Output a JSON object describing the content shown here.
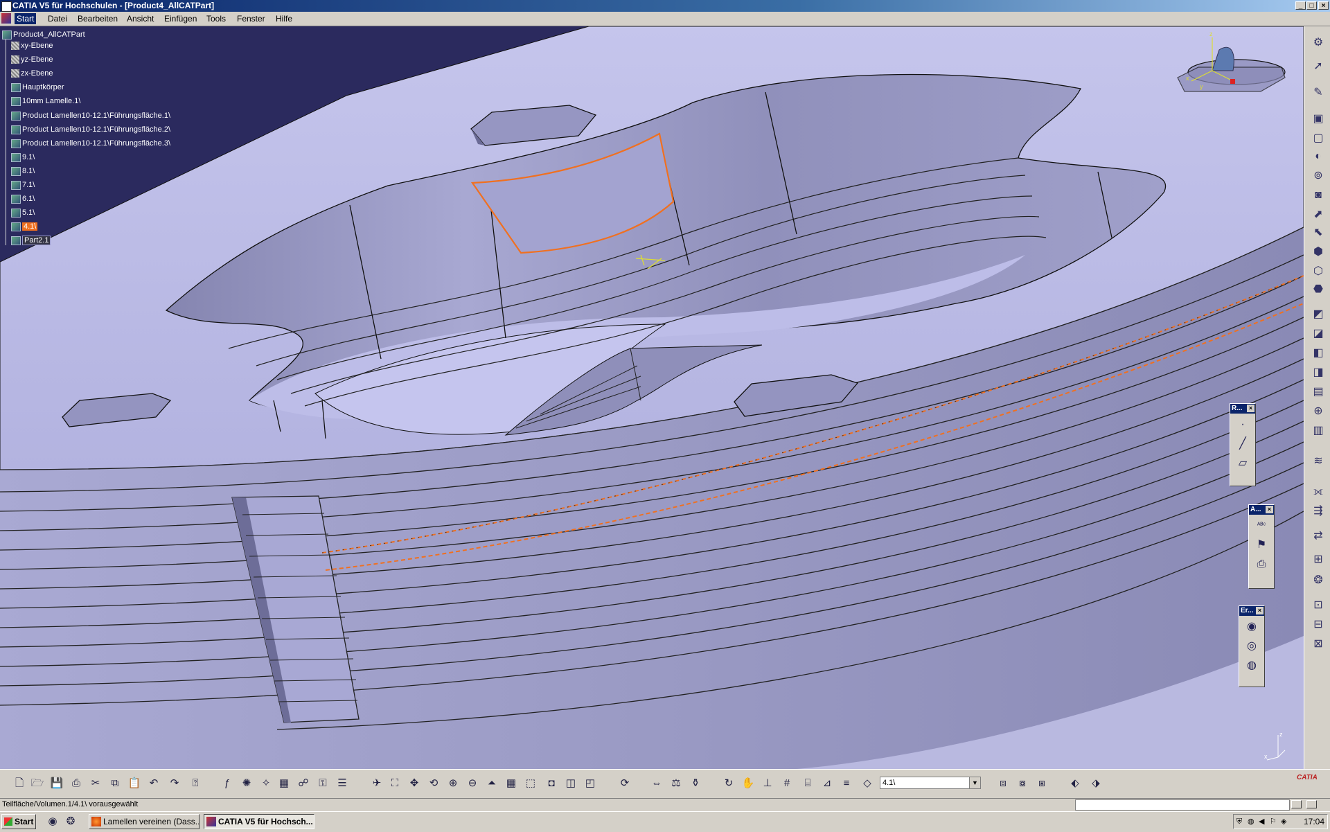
{
  "window": {
    "title": "CATIA V5 für Hochschulen - [Product4_AllCATPart]",
    "controls": {
      "minimize": "_",
      "maximize": "□",
      "close": "×"
    }
  },
  "menu": [
    "Start",
    "Datei",
    "Bearbeiten",
    "Ansicht",
    "Einfügen",
    "Tools",
    "Fenster",
    "Hilfe"
  ],
  "tree": {
    "root": "Product4_AllCATPart",
    "items": [
      {
        "label": "xy-Ebene",
        "icon": "plane-icon"
      },
      {
        "label": "yz-Ebene",
        "icon": "plane-icon"
      },
      {
        "label": "zx-Ebene",
        "icon": "plane-icon"
      },
      {
        "label": "Hauptkörper",
        "icon": "body-icon"
      },
      {
        "label": "10mm Lamelle.1\\",
        "icon": "body-icon"
      },
      {
        "label": "Product Lamellen10-12.1\\Führungsfläche.1\\",
        "icon": "body-icon"
      },
      {
        "label": "Product Lamellen10-12.1\\Führungsfläche.2\\",
        "icon": "body-icon"
      },
      {
        "label": "Product Lamellen10-12.1\\Führungsfläche.3\\",
        "icon": "body-icon"
      },
      {
        "label": "9.1\\",
        "icon": "body-icon"
      },
      {
        "label": "8.1\\",
        "icon": "body-icon"
      },
      {
        "label": "7.1\\",
        "icon": "body-icon"
      },
      {
        "label": "6.1\\",
        "icon": "body-icon"
      },
      {
        "label": "5.1\\",
        "icon": "body-icon"
      },
      {
        "label": "4.1\\",
        "icon": "body-icon",
        "selected": true
      },
      {
        "label": "Part2.1",
        "icon": "body-icon",
        "boxed": true
      }
    ]
  },
  "floating_toolbars": [
    {
      "title": "R...",
      "close": "×"
    },
    {
      "title": "A...",
      "close": "×"
    },
    {
      "title": "Er...",
      "close": "×"
    }
  ],
  "compass_labels": {
    "z": "z",
    "y": "y",
    "x": "x"
  },
  "axis_labels": {
    "z": "z",
    "x": "x"
  },
  "bottom_toolbar": {
    "combo_value": "4.1\\",
    "combo_arrow": "▼",
    "logo": "CATIA"
  },
  "status": {
    "text": "Teilfläche/Volumen.1/4.1\\ vorausgewählt"
  },
  "taskbar": {
    "start": "Start",
    "tasks": [
      {
        "label": "Lamellen vereinen (Dass...",
        "active": false
      },
      {
        "label": "CATIA V5 für Hochsch...",
        "active": true
      }
    ],
    "clock": "17:04"
  },
  "colors": {
    "viewport_bg": "#b9b9e0",
    "viewport_dark": "#2b2a5e",
    "selection_orange": "#f07020",
    "face_light": "#c7c7ee",
    "face_mid": "#9d9dc6"
  }
}
